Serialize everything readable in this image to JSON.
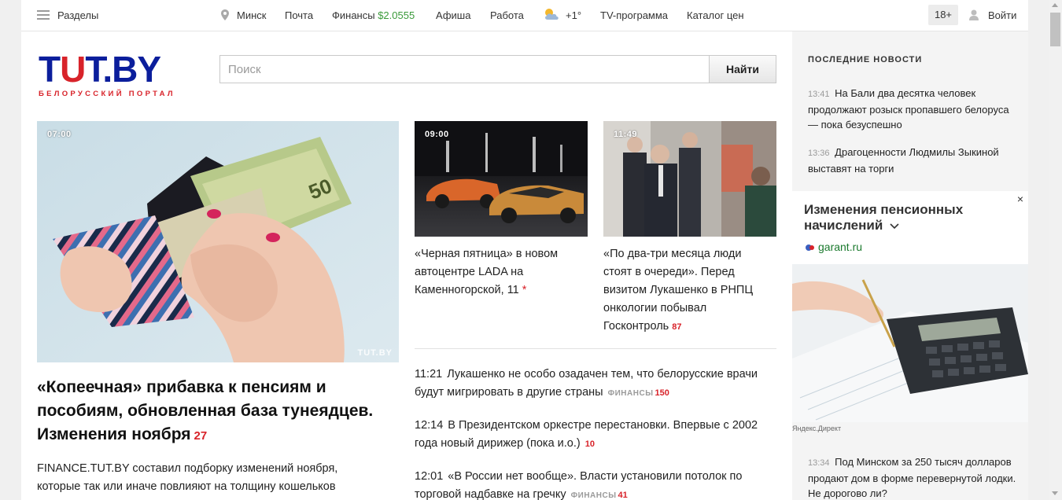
{
  "topbar": {
    "sections": "Разделы",
    "city": "Минск",
    "mail": "Почта",
    "finance": "Финансы",
    "finance_rate": "$2.0555",
    "afisha": "Афиша",
    "jobs": "Работа",
    "weather": "+1°",
    "tv": "TV-программа",
    "prices": "Каталог цен",
    "age": "18+",
    "login": "Войти"
  },
  "logo": {
    "brand_part1": "T",
    "brand_part2": "U",
    "brand_part3": "T.BY",
    "tagline": "БЕЛОРУССКИЙ ПОРТАЛ"
  },
  "search": {
    "placeholder": "Поиск",
    "button": "Найти"
  },
  "main_story": {
    "time": "07:00",
    "watermark": "TUT.BY",
    "title": "«Копеечная» прибавка к пенсиям и пособиям, обновленная база тунеядцев. Изменения ноября",
    "comments": "27",
    "lead": "FINANCE.TUT.BY составил подборку изменений ноября, которые так или иначе повлияют на толщину кошельков"
  },
  "cards": [
    {
      "time": "09:00",
      "title": "«Черная пятница» в новом автоцентре LADA на Каменногорской, 11",
      "mark": "*"
    },
    {
      "time": "11:49",
      "title": "«По два-три месяца люди стоят в очереди». Перед визитом Лукашенко в РНПЦ онкологии побывал Госконтроль",
      "comments": "87"
    }
  ],
  "news": [
    {
      "time": "11:21",
      "text": "Лукашенко не особо озадачен тем, что белорусские врачи будут мигрировать в другие страны",
      "category": "ФИНАНСЫ",
      "count": "150"
    },
    {
      "time": "12:14",
      "text": "В Президентском оркестре перестановки. Впервые с 2002 года новый дирижер (пока и.о.)",
      "category": "",
      "count": "10"
    },
    {
      "time": "12:01",
      "text": "«В России нет вообще». Власти установили потолок по торговой надбавке на гречку",
      "category": "ФИНАНСЫ",
      "count": "41"
    }
  ],
  "sidebar": {
    "heading": "ПОСЛЕДНИЕ НОВОСТИ",
    "items": [
      {
        "time": "13:41",
        "text": "На Бали два десятка человек продолжают розыск пропавшего белоруса — пока безуспешно"
      },
      {
        "time": "13:36",
        "text": "Драгоценности Людмилы Зыкиной выставят на торги"
      },
      {
        "time": "13:34",
        "text": "Под Минском за 250 тысяч долларов продают дом в форме перевернутой лодки. Не дорогово ли?"
      }
    ],
    "ad": {
      "close": "×",
      "title": "Изменения пенсионных начислений",
      "site": "garant.ru",
      "label": "Яндекс.Директ"
    }
  },
  "colors": {
    "brand_blue": "#0b1e9c",
    "brand_red": "#d8232a",
    "finance_green": "#3a9a3a"
  }
}
